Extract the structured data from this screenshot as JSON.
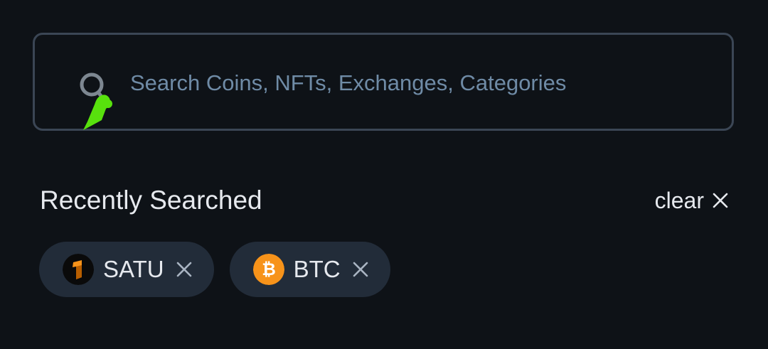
{
  "search": {
    "placeholder": "Search Coins, NFTs, Exchanges, Categories",
    "value": ""
  },
  "recent": {
    "title": "Recently Searched",
    "clear_label": "clear",
    "items": [
      {
        "label": "SATU",
        "icon": "satu-coin-icon",
        "color": "#f7931a"
      },
      {
        "label": "BTC",
        "icon": "btc-coin-icon",
        "color": "#f7931a"
      }
    ]
  },
  "colors": {
    "background": "#0e1217",
    "border": "#3b4655",
    "chip": "#222c39",
    "accent": "#58e10d",
    "text": "#e6e9ee",
    "placeholder": "#6f8ba6"
  }
}
